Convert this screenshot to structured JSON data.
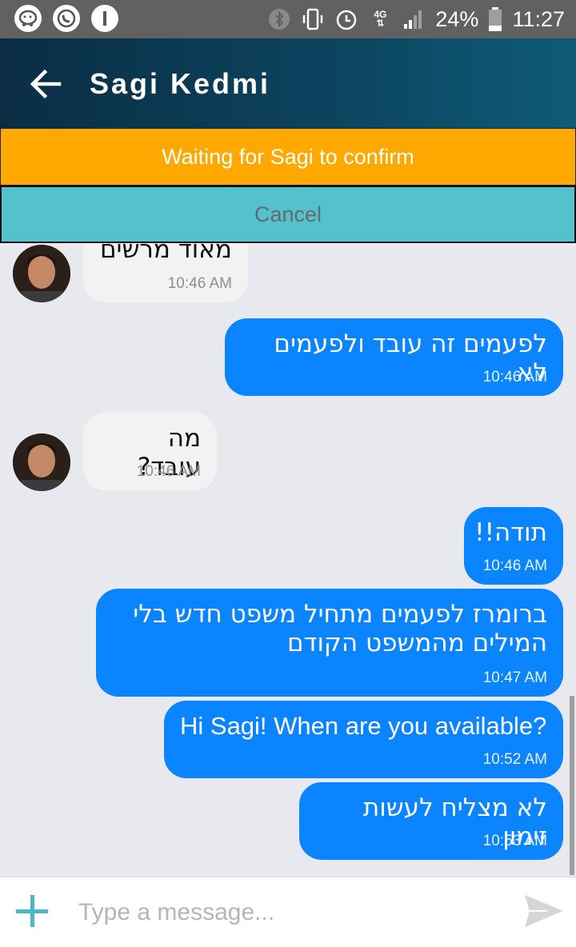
{
  "status_bar": {
    "battery": "24%",
    "time": "11:27",
    "network": "4G",
    "icons": [
      "waze-icon",
      "whatsapp-icon",
      "info-app-icon",
      "bluetooth-icon",
      "vibrate-icon",
      "alarm-icon",
      "signal-icon",
      "battery-icon"
    ]
  },
  "header": {
    "title": "Sagi Kedmi",
    "back_icon": "back-arrow-icon"
  },
  "banners": {
    "waiting": "Waiting for Sagi to confirm",
    "cancel": "Cancel"
  },
  "messages": [
    {
      "side": "in",
      "text": "מאוד מרשים",
      "time": "10:46 AM"
    },
    {
      "side": "out",
      "text": "לפעמים זה עובד ולפעמים לא",
      "time": "10:46 AM"
    },
    {
      "side": "in",
      "text": "מה עובד?",
      "time": "10:46 AM"
    },
    {
      "side": "out",
      "text": "תודה!!",
      "time": "10:46 AM"
    },
    {
      "side": "out",
      "text": "ברומרז לפעמים מתחיל משפט חדש בלי המילים מהמשפט הקודם",
      "time": "10:47 AM"
    },
    {
      "side": "out",
      "text": "Hi Sagi! When are you available?",
      "time": "10:52 AM"
    },
    {
      "side": "out",
      "text": "לא מצליח לעשות זימון",
      "time": "10:53 AM"
    }
  ],
  "composer": {
    "placeholder": "Type a message...",
    "value": ""
  },
  "colors": {
    "outgoing": "#0a84ff",
    "incoming": "#f2f2f2",
    "waiting_banner": "#ffa800",
    "cancel_banner": "#55c1cc",
    "accent": "#47b9c7"
  }
}
